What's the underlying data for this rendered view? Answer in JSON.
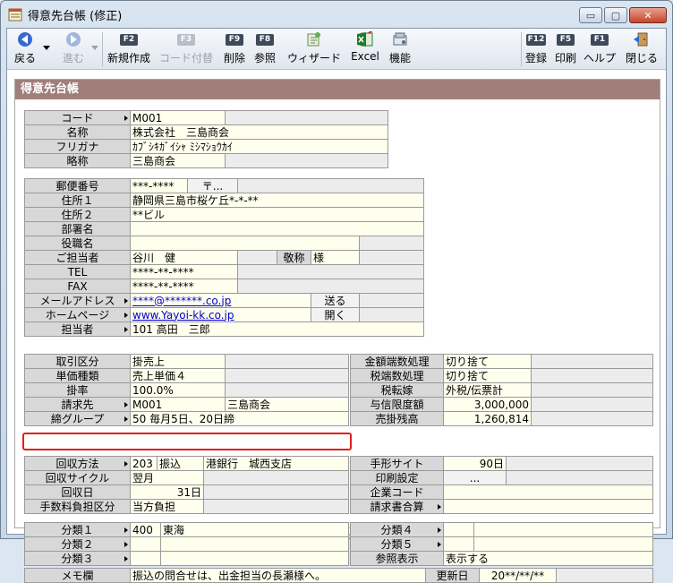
{
  "window": {
    "title": "得意先台帳 (修正)",
    "controls": {
      "minimize": "▭",
      "maximize": "▢",
      "close": "✕"
    }
  },
  "toolbar": {
    "back": {
      "label": "戻る"
    },
    "forward": {
      "label": "進む"
    },
    "new": {
      "key": "F2",
      "label": "新規作成"
    },
    "code_assign": {
      "key": "F3",
      "label": "コード付替"
    },
    "delete": {
      "key": "F9",
      "label": "削除"
    },
    "reference": {
      "key": "F8",
      "label": "参照"
    },
    "wizard": {
      "label": "ウィザード"
    },
    "excel": {
      "label": "Excel"
    },
    "function": {
      "label": "機能"
    },
    "register": {
      "key": "F12",
      "label": "登録"
    },
    "print": {
      "key": "F5",
      "label": "印刷"
    },
    "help": {
      "key": "F1",
      "label": "ヘルプ"
    },
    "close": {
      "label": "閉じる"
    }
  },
  "panel": {
    "title": "得意先台帳"
  },
  "basic": {
    "code": {
      "label": "コード",
      "value": "M001"
    },
    "name": {
      "label": "名称",
      "value": "株式会社　三島商会"
    },
    "furigana": {
      "label": "フリガナ",
      "value": "ｶﾌﾞｼｷｶﾞｲｼｬ ﾐｼﾏｼｮｳｶｲ"
    },
    "short_name": {
      "label": "略称",
      "value": "三島商会"
    }
  },
  "address": {
    "postal": {
      "label": "郵便番号",
      "value": "***-****",
      "button": "〒..."
    },
    "address1": {
      "label": "住所１",
      "value": "静岡県三島市桜ケ丘*-*-**"
    },
    "address2": {
      "label": "住所２",
      "value": "**ビル"
    },
    "department": {
      "label": "部署名",
      "value": ""
    },
    "position": {
      "label": "役職名",
      "value": ""
    },
    "contact": {
      "label": "ご担当者",
      "value": "谷川　健",
      "honorific_label": "敬称",
      "honorific": "様"
    },
    "tel": {
      "label": "TEL",
      "value": "****-**-****"
    },
    "fax": {
      "label": "FAX",
      "value": "****-**-****"
    },
    "email": {
      "label": "メールアドレス",
      "value": "****@*******.co.jp",
      "button": "送る"
    },
    "homepage": {
      "label": "ホームページ",
      "value": "www.Yayoi-kk.co.jp",
      "button": "開く"
    },
    "staff": {
      "label": "担当者",
      "code": "101",
      "name": "高田　三郎"
    }
  },
  "trade": {
    "trade_type": {
      "label": "取引区分",
      "value": "掛売上"
    },
    "price_type": {
      "label": "単価種類",
      "value": "売上単価４"
    },
    "rate": {
      "label": "掛率",
      "value": "100.0%"
    },
    "billing": {
      "label": "請求先",
      "code": "M001",
      "name": "三島商会"
    },
    "closing": {
      "label": "締グループ",
      "code": "50",
      "name": "毎月5日、20日締"
    },
    "rounding": {
      "label": "金額端数処理",
      "value": "切り捨て"
    },
    "tax_rounding": {
      "label": "税端数処理",
      "value": "切り捨て"
    },
    "tax_transfer": {
      "label": "税転嫁",
      "value": "外税/伝票計"
    },
    "credit_limit": {
      "label": "与信限度額",
      "value": "3,000,000"
    },
    "receivable": {
      "label": "売掛残高",
      "value": "1,260,814"
    }
  },
  "collection": {
    "method": {
      "label": "回収方法",
      "code": "203",
      "type": "振込",
      "bank": "港銀行　城西支店"
    },
    "cycle": {
      "label": "回収サイクル",
      "value": "翌月"
    },
    "day": {
      "label": "回収日",
      "value": "31日"
    },
    "fee": {
      "label": "手数料負担区分",
      "value": "当方負担"
    },
    "note_site": {
      "label": "手形サイト",
      "value": "90日"
    },
    "print_setting": {
      "label": "印刷設定",
      "button": "..."
    },
    "company_code": {
      "label": "企業コード",
      "value": ""
    },
    "invoice_total": {
      "label": "請求書合算",
      "value": ""
    }
  },
  "classification": {
    "cat1": {
      "label": "分類１",
      "code": "400",
      "name": "東海"
    },
    "cat2": {
      "label": "分類２",
      "code": "",
      "name": ""
    },
    "cat3": {
      "label": "分類３",
      "code": "",
      "name": ""
    },
    "cat4": {
      "label": "分類４",
      "code": "",
      "name": ""
    },
    "cat5": {
      "label": "分類５",
      "code": "",
      "name": ""
    },
    "display": {
      "label": "参照表示",
      "value": "表示する"
    },
    "memo": {
      "label": "メモ欄",
      "value": "振込の問合せは、出金担当の長瀬様へ。"
    },
    "updated": {
      "label": "更新日",
      "value": "20**/**/**"
    }
  }
}
